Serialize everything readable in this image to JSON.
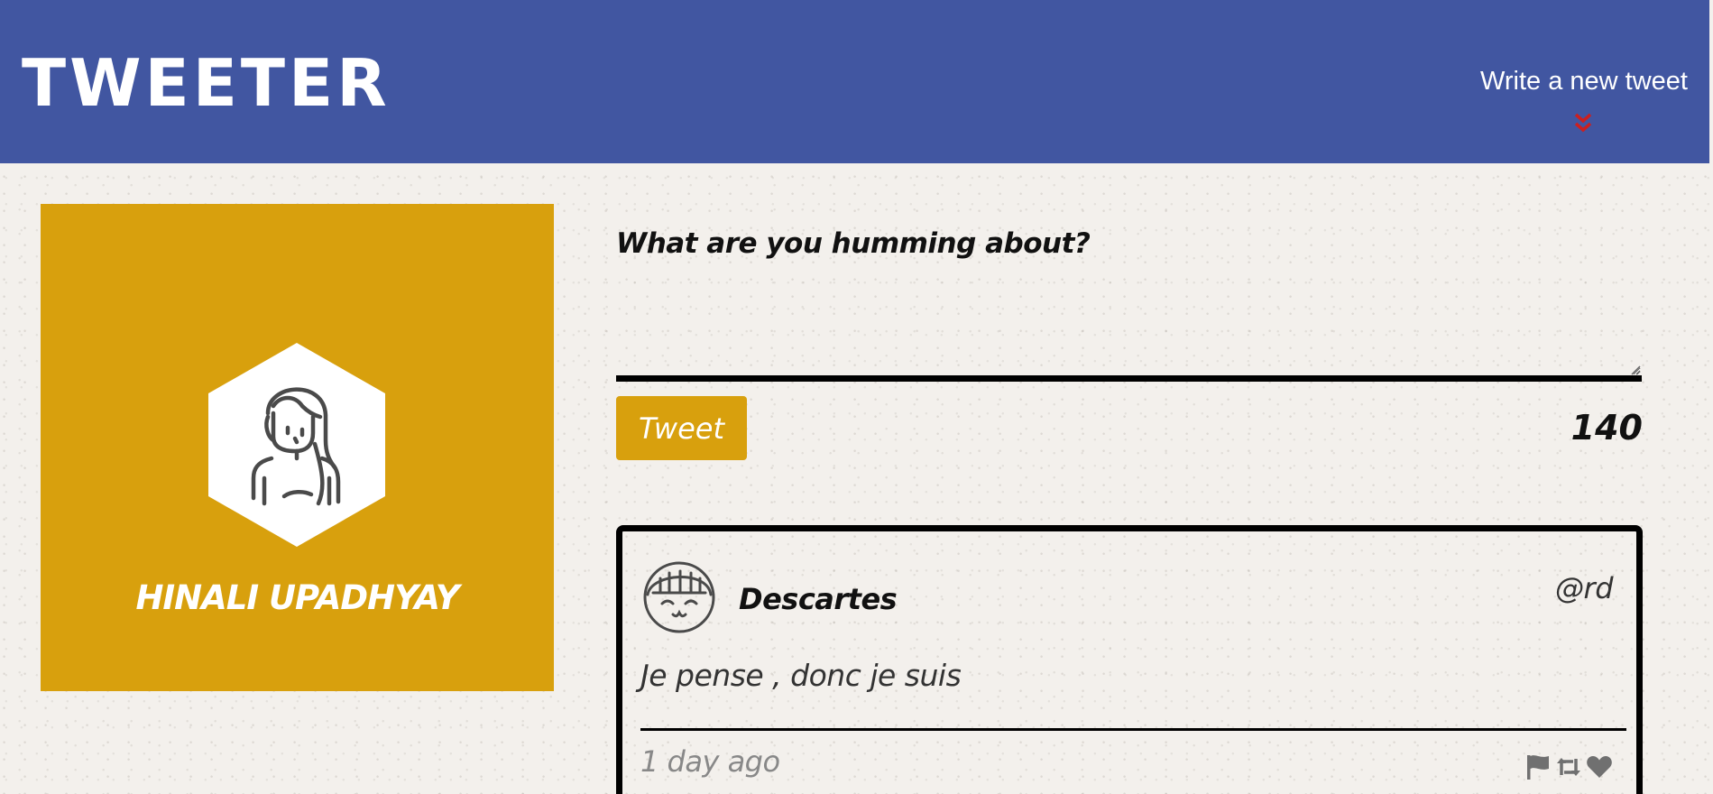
{
  "nav": {
    "logo": "TWEETER",
    "compose_toggle_label": "Write a new tweet",
    "toggle_icon": "chevron-double-down-icon",
    "background": "#4156a1",
    "toggle_icon_color": "#cc1f1f"
  },
  "profile": {
    "name": "HINALI UPADHYAY",
    "avatar_icon": "user-avatar-icon",
    "card_color": "#d8a00d"
  },
  "compose": {
    "heading": "What are you humming about?",
    "textarea_value": "",
    "button_label": "Tweet",
    "char_counter": "140",
    "accent_color": "#d8a00d"
  },
  "tweets": [
    {
      "author_name": "Descartes",
      "handle": "@rd",
      "content": "Je pense , donc je suis",
      "time_ago": "1 day ago",
      "avatar_icon": "author-avatar-icon",
      "actions": [
        "flag-icon",
        "retweet-icon",
        "heart-icon"
      ]
    }
  ]
}
